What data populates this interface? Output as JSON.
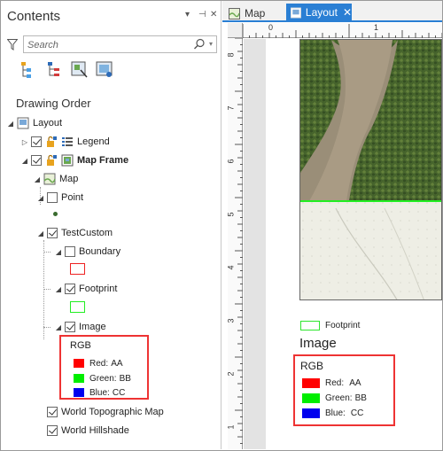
{
  "contents_pane": {
    "title": "Contents",
    "header_buttons": [
      "▾",
      "⊣",
      "✕"
    ],
    "search": {
      "placeholder": "Search",
      "value": ""
    },
    "section_label": "Drawing Order",
    "view_buttons": [
      "list-by-drawing-order",
      "list-by-source",
      "list-by-selection",
      "list-by-snapping"
    ],
    "tree": {
      "layout": "Layout",
      "legend": "Legend",
      "map_frame": "Map Frame",
      "map": "Map",
      "point": "Point",
      "testcustom": "TestCustom",
      "boundary": "Boundary",
      "footprint": "Footprint",
      "image": "Image",
      "world_topo": "World Topographic Map",
      "world_hillshade": "World Hillshade"
    },
    "checked": {
      "legend": true,
      "map_frame": true,
      "point": false,
      "testcustom": true,
      "boundary": false,
      "footprint": true,
      "image": true,
      "world_topo": true,
      "world_hillshade": true
    },
    "rgb": {
      "title": "RGB",
      "rows": [
        {
          "label": "Red:",
          "value": "AA",
          "color": "#ff0000"
        },
        {
          "label": "Green:",
          "value": "BB",
          "color": "#00ee00"
        },
        {
          "label": "Blue:",
          "value": "CC",
          "color": "#0000ee"
        }
      ]
    },
    "colors": {
      "boundary_outline": "#ee2222",
      "footprint_outline": "#22ee22",
      "accent": "#2a7fd4",
      "highlight_box": "#ee3333"
    }
  },
  "view": {
    "tabs": [
      {
        "label": "Map",
        "active": false
      },
      {
        "label": "Layout",
        "active": true,
        "close": "✕"
      }
    ],
    "ruler_top_numbers": [
      "0",
      "1"
    ],
    "ruler_left_numbers": [
      "8",
      "7",
      "6",
      "5",
      "4",
      "3",
      "2",
      "1"
    ],
    "legend": {
      "footprint_label": "Footprint",
      "image_label": "Image",
      "rgb": {
        "title": "RGB",
        "rows": [
          {
            "label": "Red:",
            "value": "AA",
            "color": "#ff0000"
          },
          {
            "label": "Green:",
            "value": "BB",
            "color": "#00ee00"
          },
          {
            "label": "Blue:",
            "value": "CC",
            "color": "#0000ee"
          }
        ]
      }
    }
  }
}
